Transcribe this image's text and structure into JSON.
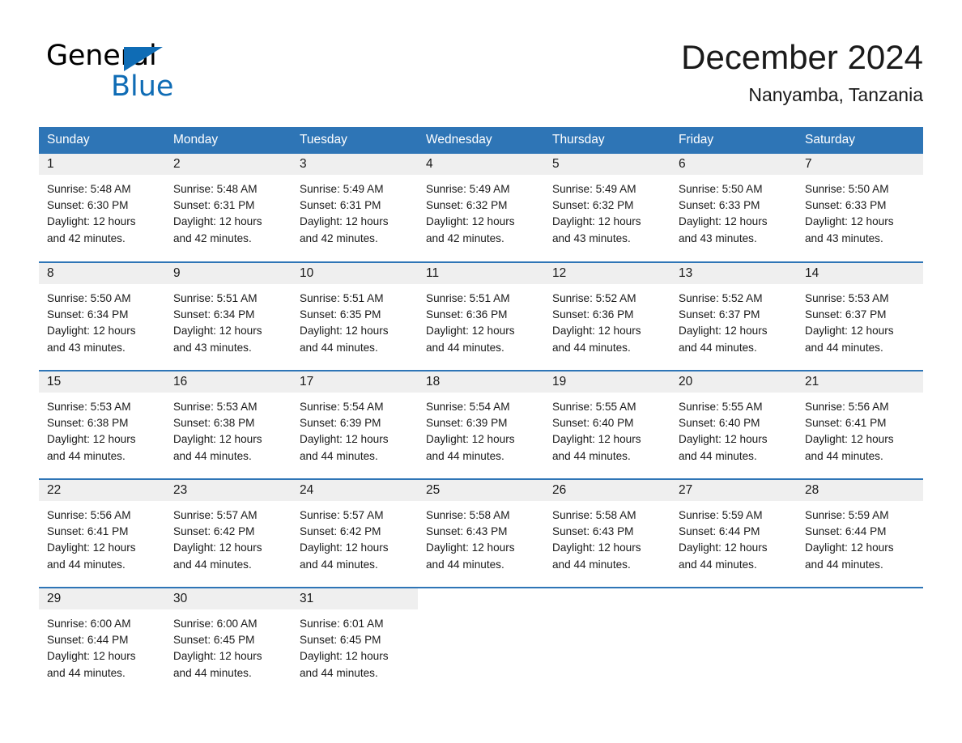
{
  "brand": {
    "name_part1": "General",
    "name_part2": "Blue",
    "accent_color": "#0f6cb5"
  },
  "header": {
    "title": "December 2024",
    "subtitle": "Nanyamba, Tanzania",
    "header_bg_color": "#2e75b6",
    "daynum_band_color": "#efefef"
  },
  "weekdays": [
    "Sunday",
    "Monday",
    "Tuesday",
    "Wednesday",
    "Thursday",
    "Friday",
    "Saturday"
  ],
  "labels": {
    "sunrise_prefix": "Sunrise:",
    "sunset_prefix": "Sunset:",
    "daylight_prefix": "Daylight:"
  },
  "weeks": [
    [
      {
        "day": "1",
        "sunrise": "Sunrise: 5:48 AM",
        "sunset": "Sunset: 6:30 PM",
        "daylight_1": "Daylight: 12 hours",
        "daylight_2": "and 42 minutes."
      },
      {
        "day": "2",
        "sunrise": "Sunrise: 5:48 AM",
        "sunset": "Sunset: 6:31 PM",
        "daylight_1": "Daylight: 12 hours",
        "daylight_2": "and 42 minutes."
      },
      {
        "day": "3",
        "sunrise": "Sunrise: 5:49 AM",
        "sunset": "Sunset: 6:31 PM",
        "daylight_1": "Daylight: 12 hours",
        "daylight_2": "and 42 minutes."
      },
      {
        "day": "4",
        "sunrise": "Sunrise: 5:49 AM",
        "sunset": "Sunset: 6:32 PM",
        "daylight_1": "Daylight: 12 hours",
        "daylight_2": "and 42 minutes."
      },
      {
        "day": "5",
        "sunrise": "Sunrise: 5:49 AM",
        "sunset": "Sunset: 6:32 PM",
        "daylight_1": "Daylight: 12 hours",
        "daylight_2": "and 43 minutes."
      },
      {
        "day": "6",
        "sunrise": "Sunrise: 5:50 AM",
        "sunset": "Sunset: 6:33 PM",
        "daylight_1": "Daylight: 12 hours",
        "daylight_2": "and 43 minutes."
      },
      {
        "day": "7",
        "sunrise": "Sunrise: 5:50 AM",
        "sunset": "Sunset: 6:33 PM",
        "daylight_1": "Daylight: 12 hours",
        "daylight_2": "and 43 minutes."
      }
    ],
    [
      {
        "day": "8",
        "sunrise": "Sunrise: 5:50 AM",
        "sunset": "Sunset: 6:34 PM",
        "daylight_1": "Daylight: 12 hours",
        "daylight_2": "and 43 minutes."
      },
      {
        "day": "9",
        "sunrise": "Sunrise: 5:51 AM",
        "sunset": "Sunset: 6:34 PM",
        "daylight_1": "Daylight: 12 hours",
        "daylight_2": "and 43 minutes."
      },
      {
        "day": "10",
        "sunrise": "Sunrise: 5:51 AM",
        "sunset": "Sunset: 6:35 PM",
        "daylight_1": "Daylight: 12 hours",
        "daylight_2": "and 44 minutes."
      },
      {
        "day": "11",
        "sunrise": "Sunrise: 5:51 AM",
        "sunset": "Sunset: 6:36 PM",
        "daylight_1": "Daylight: 12 hours",
        "daylight_2": "and 44 minutes."
      },
      {
        "day": "12",
        "sunrise": "Sunrise: 5:52 AM",
        "sunset": "Sunset: 6:36 PM",
        "daylight_1": "Daylight: 12 hours",
        "daylight_2": "and 44 minutes."
      },
      {
        "day": "13",
        "sunrise": "Sunrise: 5:52 AM",
        "sunset": "Sunset: 6:37 PM",
        "daylight_1": "Daylight: 12 hours",
        "daylight_2": "and 44 minutes."
      },
      {
        "day": "14",
        "sunrise": "Sunrise: 5:53 AM",
        "sunset": "Sunset: 6:37 PM",
        "daylight_1": "Daylight: 12 hours",
        "daylight_2": "and 44 minutes."
      }
    ],
    [
      {
        "day": "15",
        "sunrise": "Sunrise: 5:53 AM",
        "sunset": "Sunset: 6:38 PM",
        "daylight_1": "Daylight: 12 hours",
        "daylight_2": "and 44 minutes."
      },
      {
        "day": "16",
        "sunrise": "Sunrise: 5:53 AM",
        "sunset": "Sunset: 6:38 PM",
        "daylight_1": "Daylight: 12 hours",
        "daylight_2": "and 44 minutes."
      },
      {
        "day": "17",
        "sunrise": "Sunrise: 5:54 AM",
        "sunset": "Sunset: 6:39 PM",
        "daylight_1": "Daylight: 12 hours",
        "daylight_2": "and 44 minutes."
      },
      {
        "day": "18",
        "sunrise": "Sunrise: 5:54 AM",
        "sunset": "Sunset: 6:39 PM",
        "daylight_1": "Daylight: 12 hours",
        "daylight_2": "and 44 minutes."
      },
      {
        "day": "19",
        "sunrise": "Sunrise: 5:55 AM",
        "sunset": "Sunset: 6:40 PM",
        "daylight_1": "Daylight: 12 hours",
        "daylight_2": "and 44 minutes."
      },
      {
        "day": "20",
        "sunrise": "Sunrise: 5:55 AM",
        "sunset": "Sunset: 6:40 PM",
        "daylight_1": "Daylight: 12 hours",
        "daylight_2": "and 44 minutes."
      },
      {
        "day": "21",
        "sunrise": "Sunrise: 5:56 AM",
        "sunset": "Sunset: 6:41 PM",
        "daylight_1": "Daylight: 12 hours",
        "daylight_2": "and 44 minutes."
      }
    ],
    [
      {
        "day": "22",
        "sunrise": "Sunrise: 5:56 AM",
        "sunset": "Sunset: 6:41 PM",
        "daylight_1": "Daylight: 12 hours",
        "daylight_2": "and 44 minutes."
      },
      {
        "day": "23",
        "sunrise": "Sunrise: 5:57 AM",
        "sunset": "Sunset: 6:42 PM",
        "daylight_1": "Daylight: 12 hours",
        "daylight_2": "and 44 minutes."
      },
      {
        "day": "24",
        "sunrise": "Sunrise: 5:57 AM",
        "sunset": "Sunset: 6:42 PM",
        "daylight_1": "Daylight: 12 hours",
        "daylight_2": "and 44 minutes."
      },
      {
        "day": "25",
        "sunrise": "Sunrise: 5:58 AM",
        "sunset": "Sunset: 6:43 PM",
        "daylight_1": "Daylight: 12 hours",
        "daylight_2": "and 44 minutes."
      },
      {
        "day": "26",
        "sunrise": "Sunrise: 5:58 AM",
        "sunset": "Sunset: 6:43 PM",
        "daylight_1": "Daylight: 12 hours",
        "daylight_2": "and 44 minutes."
      },
      {
        "day": "27",
        "sunrise": "Sunrise: 5:59 AM",
        "sunset": "Sunset: 6:44 PM",
        "daylight_1": "Daylight: 12 hours",
        "daylight_2": "and 44 minutes."
      },
      {
        "day": "28",
        "sunrise": "Sunrise: 5:59 AM",
        "sunset": "Sunset: 6:44 PM",
        "daylight_1": "Daylight: 12 hours",
        "daylight_2": "and 44 minutes."
      }
    ],
    [
      {
        "day": "29",
        "sunrise": "Sunrise: 6:00 AM",
        "sunset": "Sunset: 6:44 PM",
        "daylight_1": "Daylight: 12 hours",
        "daylight_2": "and 44 minutes."
      },
      {
        "day": "30",
        "sunrise": "Sunrise: 6:00 AM",
        "sunset": "Sunset: 6:45 PM",
        "daylight_1": "Daylight: 12 hours",
        "daylight_2": "and 44 minutes."
      },
      {
        "day": "31",
        "sunrise": "Sunrise: 6:01 AM",
        "sunset": "Sunset: 6:45 PM",
        "daylight_1": "Daylight: 12 hours",
        "daylight_2": "and 44 minutes."
      },
      {
        "day": "",
        "sunrise": "",
        "sunset": "",
        "daylight_1": "",
        "daylight_2": ""
      },
      {
        "day": "",
        "sunrise": "",
        "sunset": "",
        "daylight_1": "",
        "daylight_2": ""
      },
      {
        "day": "",
        "sunrise": "",
        "sunset": "",
        "daylight_1": "",
        "daylight_2": ""
      },
      {
        "day": "",
        "sunrise": "",
        "sunset": "",
        "daylight_1": "",
        "daylight_2": ""
      }
    ]
  ]
}
